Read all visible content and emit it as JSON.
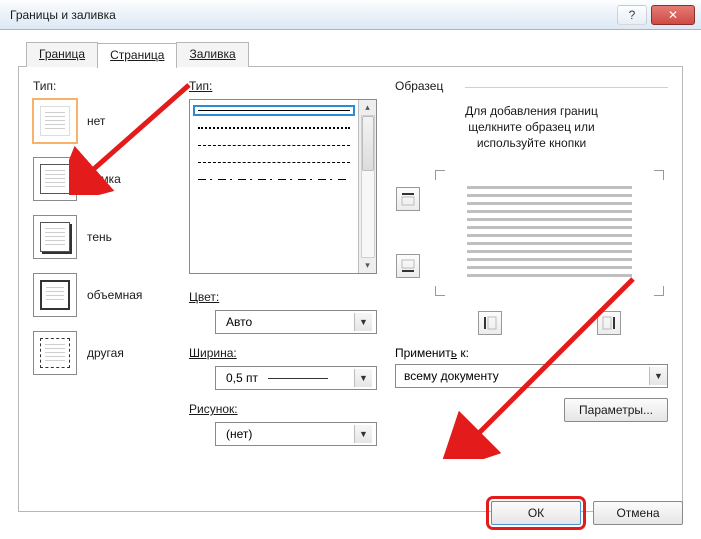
{
  "window": {
    "title": "Границы и заливка"
  },
  "tabs": {
    "borders": "Граница",
    "page": "Страница",
    "shading": "Заливка"
  },
  "left": {
    "label": "Тип:",
    "none": "нет",
    "box": "рамка",
    "shadow": "тень",
    "threeD": "объемная",
    "custom": "другая"
  },
  "mid": {
    "style_label": "Тип:",
    "color_label": "Цвет:",
    "color_value": "Авто",
    "width_label": "Ширина:",
    "width_value": "0,5 пт",
    "art_label": "Рисунок:",
    "art_value": "(нет)"
  },
  "right": {
    "legend": "Образец",
    "hint1": "Для добавления границ",
    "hint2": "щелкните образец или",
    "hint3": "используйте кнопки",
    "apply_label": "Применить к:",
    "apply_value": "всему документу",
    "options": "Параметры..."
  },
  "footer": {
    "ok": "ОК",
    "cancel": "Отмена"
  }
}
